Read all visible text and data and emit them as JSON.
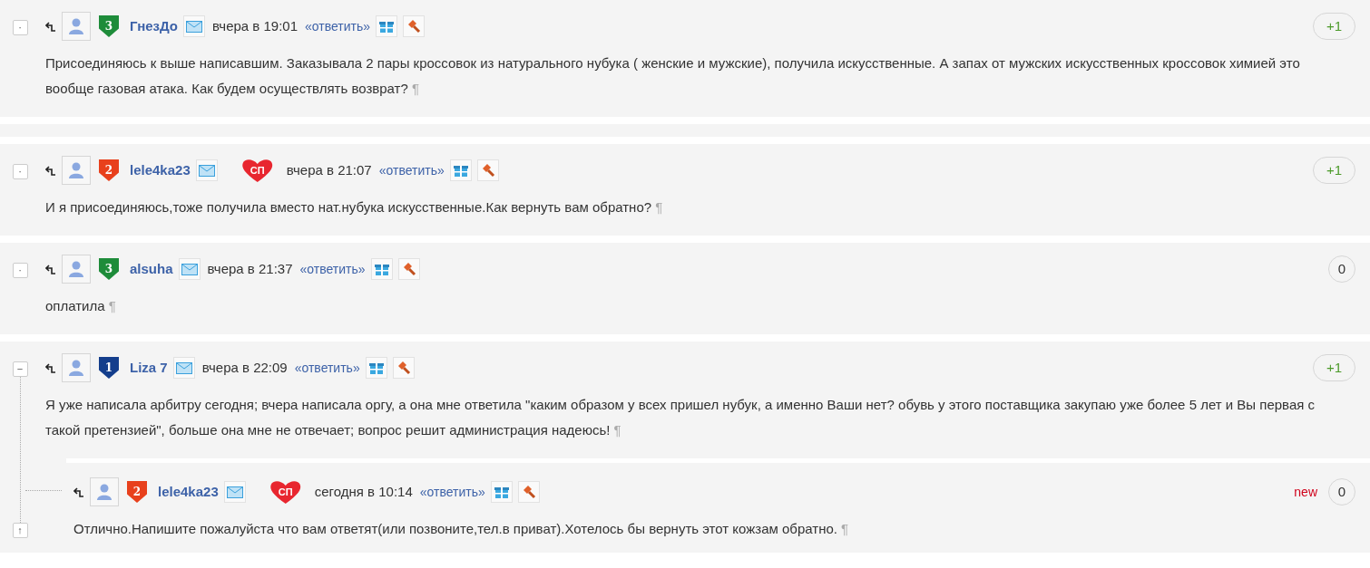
{
  "comments": [
    {
      "toggle": "·",
      "author": "ГнезДо",
      "rank": {
        "text": "3",
        "color": "#1e8c3a"
      },
      "time": "вчера в 19:01",
      "reply_link": "«ответить»",
      "text": "Присоединяюсь к выше написавшим. Заказывала 2 пары кроссовок из натурального нубука ( женские и мужские), получила искусственные. А запах от мужских искусственных кроссовок химией это вообще газовая атака. Как будем осуществлять возврат?",
      "pilcrow": "¶",
      "score": {
        "text": "+1",
        "kind": "positive"
      }
    },
    {
      "toggle": "·",
      "author": "lele4ka23",
      "rank": {
        "text": "2",
        "color": "#e8401c"
      },
      "sp_badge": "СП",
      "time": "вчера в 21:07",
      "reply_link": "«ответить»",
      "text": "И я присоединяюсь,тоже получила вместо нат.нубука искусственные.Как вернуть вам обратно?",
      "pilcrow": "¶",
      "score": {
        "text": "+1",
        "kind": "positive"
      }
    },
    {
      "toggle": "·",
      "author": "alsuha",
      "rank": {
        "text": "3",
        "color": "#1e8c3a"
      },
      "time": "вчера в 21:37",
      "reply_link": "«ответить»",
      "text": "оплатила",
      "pilcrow": "¶",
      "score": {
        "text": "0",
        "kind": "neutral"
      }
    },
    {
      "toggle": "−",
      "author": "Liza 7",
      "rank": {
        "text": "1",
        "color": "#143e8c"
      },
      "time": "вчера в 22:09",
      "reply_link": "«ответить»",
      "text": "Я уже написала арбитру сегодня; вчера написала оргу, а она мне ответила \"каким образом у всех пришел нубук, а именно Ваши нет? обувь у этого поставщика закупаю уже более 5 лет и Вы первая с такой претензией\", больше она мне не отвечает; вопрос решит администрация надеюсь!",
      "pilcrow": "¶",
      "score": {
        "text": "+1",
        "kind": "positive"
      },
      "up_button": "↑",
      "children": [
        {
          "author": "lele4ka23",
          "rank": {
            "text": "2",
            "color": "#e8401c"
          },
          "sp_badge": "СП",
          "time": "сегодня в 10:14",
          "reply_link": "«ответить»",
          "text": "Отлично.Напишите пожалуйста что вам ответят(или позвоните,тел.в приват).Хотелось бы вернуть этот кожзам обратно.",
          "pilcrow": "¶",
          "new_label": "new",
          "score": {
            "text": "0",
            "kind": "neutral"
          }
        }
      ]
    }
  ]
}
